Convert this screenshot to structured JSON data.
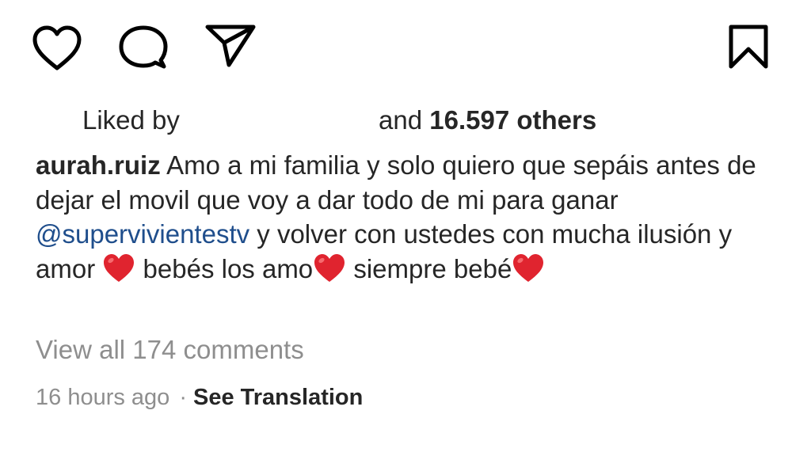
{
  "actions": {
    "like_icon": "heart-outline-icon",
    "comment_icon": "comment-bubble-icon",
    "share_icon": "paper-plane-icon",
    "save_icon": "bookmark-icon"
  },
  "likes": {
    "liked_by_label": "Liked by",
    "and_label": "and",
    "count": "16.597 others"
  },
  "caption": {
    "username": "aurah.ruiz",
    "text_part_1": "Amo a mi familia y solo quiero que sepáis antes de dejar el movil que voy a dar todo de mi para ganar",
    "mention": "@supervivientestv",
    "text_part_2": "y volver con ustedes con mucha ilusión y amor",
    "text_part_3": "bebés los amo",
    "text_part_4": "siempre bebé",
    "emoji": "red-heart"
  },
  "comments": {
    "view_all_label": "View all 174 comments"
  },
  "meta": {
    "timestamp": "16 hours ago",
    "separator": "·",
    "translation_label": "See Translation"
  },
  "colors": {
    "text": "#262626",
    "secondary": "#8e8e8e",
    "mention": "#1f4e8c",
    "heart": "#e0242f"
  }
}
